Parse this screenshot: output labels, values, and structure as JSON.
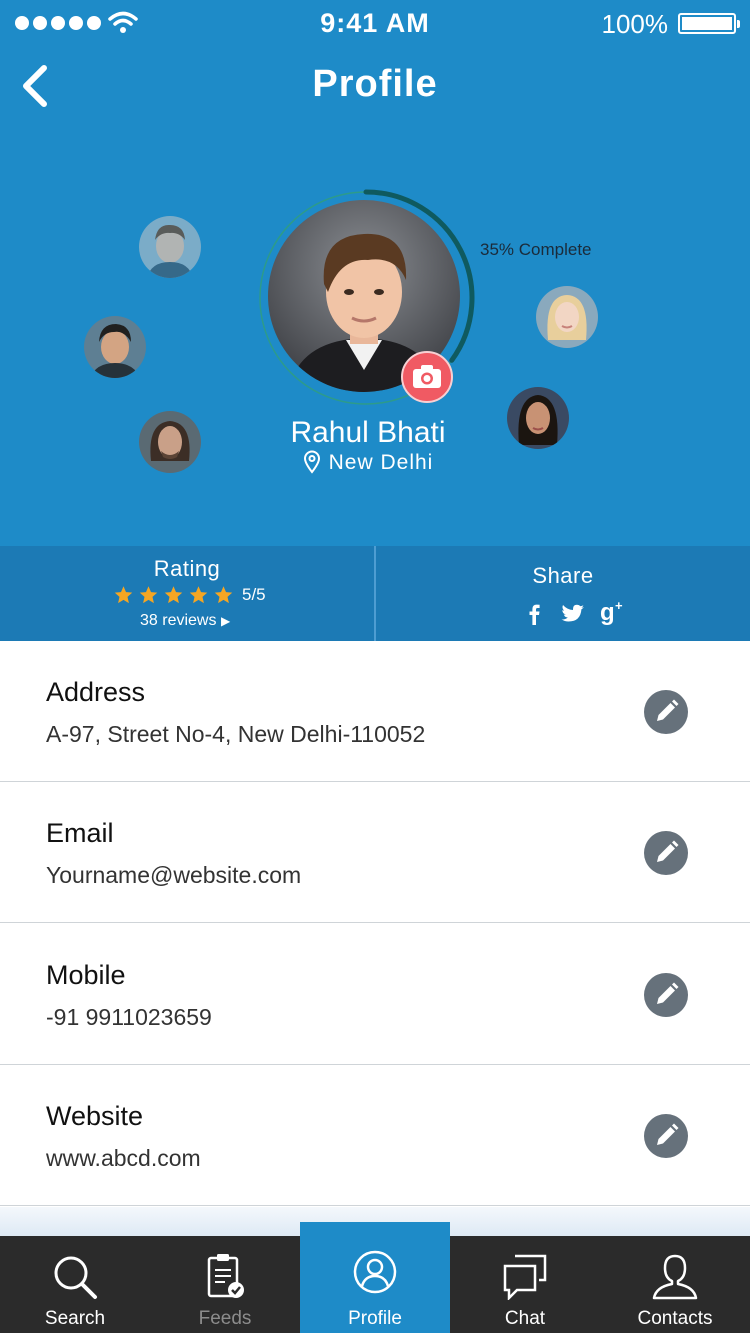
{
  "status_bar": {
    "time": "9:41 AM",
    "battery": "100%"
  },
  "header": {
    "title": "Profile"
  },
  "profile": {
    "name": "Rahul Bhati",
    "location": "New Delhi",
    "completion_label": "35% Complete",
    "completion": 0.35
  },
  "stats": {
    "rating_title": "Rating",
    "rating_value": "5/5",
    "stars_filled": 5,
    "reviews": "38 reviews",
    "share_title": "Share",
    "share_icons": [
      "facebook-icon",
      "twitter-icon",
      "google-plus-icon"
    ]
  },
  "details": [
    {
      "label": "Address",
      "value": "A-97, Street No-4, New Delhi-110052"
    },
    {
      "label": "Email",
      "value": "Yourname@website.com"
    },
    {
      "label": "Mobile",
      "value": "-91 9911023659"
    },
    {
      "label": "Website",
      "value": "www.abcd.com"
    }
  ],
  "tabs": [
    {
      "label": "Search",
      "icon": "search-icon"
    },
    {
      "label": "Feeds",
      "icon": "clipboard-icon"
    },
    {
      "label": "Profile",
      "icon": "user-circle-icon"
    },
    {
      "label": "Chat",
      "icon": "chat-icon"
    },
    {
      "label": "Contacts",
      "icon": "contact-icon"
    }
  ],
  "active_tab": "Profile",
  "colors": {
    "primary": "#1e8bc8",
    "stats_bar": "#1c7ab5",
    "accent": "#f05a63",
    "star": "#f5a623",
    "tabbar": "#2b2b2b"
  }
}
